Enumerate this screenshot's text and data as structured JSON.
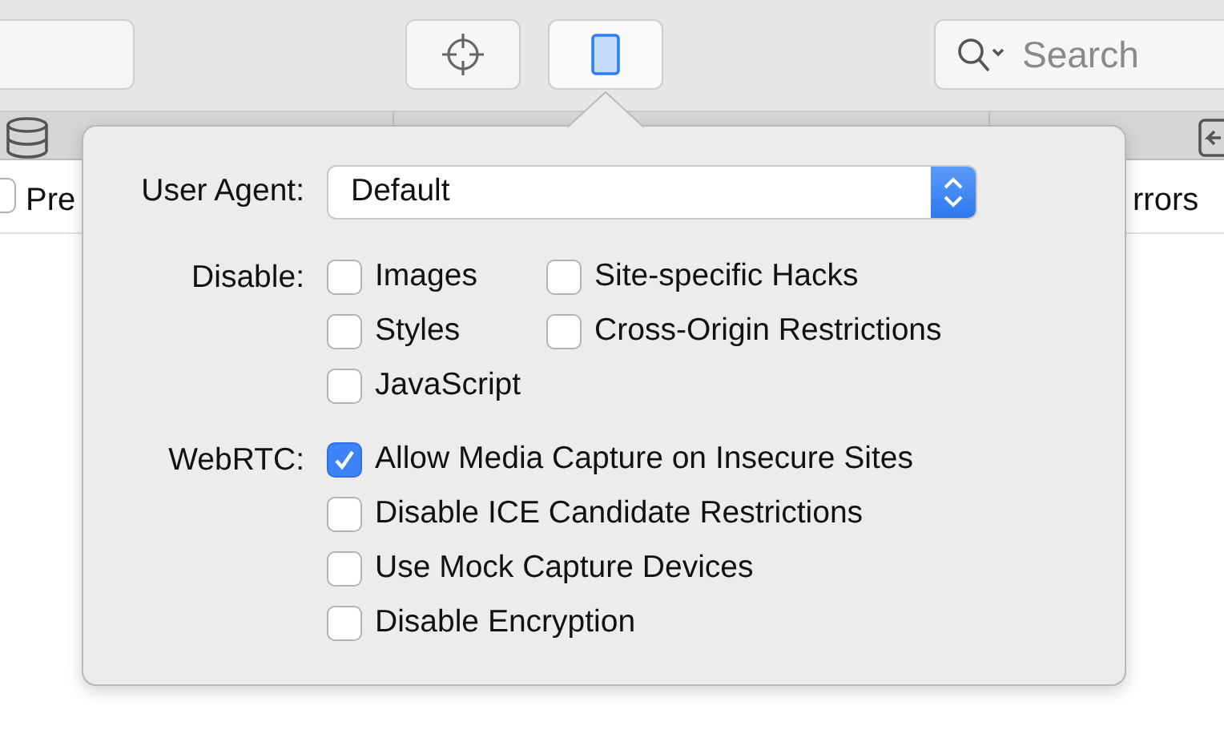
{
  "toolbar": {
    "buttons": [
      {
        "kind": "blank"
      },
      {
        "kind": "crosshair",
        "selected": false
      },
      {
        "kind": "device",
        "selected": true
      }
    ],
    "search": {
      "placeholder": "Search"
    }
  },
  "filter_row": {
    "checkbox_label": "Pre",
    "checked": false,
    "right_text": "rrors"
  },
  "popover": {
    "user_agent": {
      "label": "User Agent:",
      "value": "Default"
    },
    "groups": [
      {
        "label": "Disable:",
        "columns": [
          [
            {
              "label": "Images",
              "checked": false
            },
            {
              "label": "Styles",
              "checked": false
            },
            {
              "label": "JavaScript",
              "checked": false
            }
          ],
          [
            {
              "label": "Site-specific Hacks",
              "checked": false
            },
            {
              "label": "Cross-Origin Restrictions",
              "checked": false
            }
          ]
        ]
      },
      {
        "label": "WebRTC:",
        "columns": [
          [
            {
              "label": "Allow Media Capture on Insecure Sites",
              "checked": true
            },
            {
              "label": "Disable ICE Candidate Restrictions",
              "checked": false
            },
            {
              "label": "Use Mock Capture Devices",
              "checked": false
            },
            {
              "label": "Disable Encryption",
              "checked": false
            }
          ]
        ]
      }
    ]
  }
}
